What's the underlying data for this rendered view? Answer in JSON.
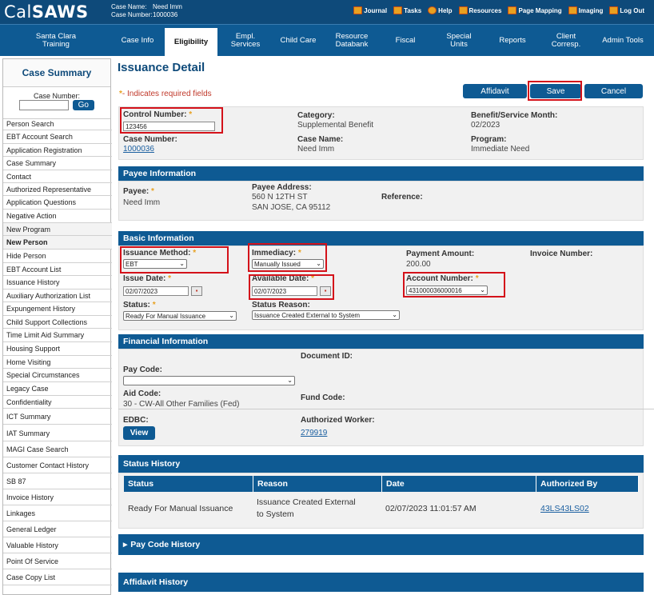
{
  "header": {
    "logo_prefix": "Cal",
    "logo_bold": "SAWS",
    "case_name_label": "Case Name:",
    "case_name": "Need Imm",
    "case_number_label": "Case Number:",
    "case_number": "1000036",
    "links": [
      {
        "label": "Journal",
        "icon": "journal-icon"
      },
      {
        "label": "Tasks",
        "icon": "tasks-icon"
      },
      {
        "label": "Help",
        "icon": "help-icon"
      },
      {
        "label": "Resources",
        "icon": "resources-icon"
      },
      {
        "label": "Page Mapping",
        "icon": "page-mapping-icon"
      },
      {
        "label": "Imaging",
        "icon": "imaging-icon"
      },
      {
        "label": "Log Out",
        "icon": "logout-icon"
      }
    ]
  },
  "nav": {
    "county_line1": "Santa Clara",
    "county_line2": "Training",
    "tabs": [
      {
        "line1": "Case Info",
        "line2": ""
      },
      {
        "line1": "Eligibility",
        "line2": ""
      },
      {
        "line1": "Empl.",
        "line2": "Services"
      },
      {
        "line1": "Child Care",
        "line2": ""
      },
      {
        "line1": "Resource",
        "line2": "Databank"
      },
      {
        "line1": "Fiscal",
        "line2": ""
      },
      {
        "line1": "Special",
        "line2": "Units"
      },
      {
        "line1": "Reports",
        "line2": ""
      },
      {
        "line1": "Client",
        "line2": "Corresp."
      },
      {
        "line1": "Admin Tools",
        "line2": ""
      }
    ]
  },
  "sidebar": {
    "title": "Case Summary",
    "case_number_label": "Case Number:",
    "go_label": "Go",
    "items": [
      "Person Search",
      "EBT Account Search",
      "Application Registration",
      "Case Summary",
      "Contact",
      "Authorized Representative",
      "Application Questions",
      "Negative Action",
      "New Program",
      "New Person",
      "Hide Person",
      "EBT Account List",
      "Issuance History",
      "Auxiliary Authorization List",
      "Expungement History",
      "Child Support Collections",
      "Time Limit Aid Summary",
      "Housing Support",
      "Home Visiting",
      "Special Circumstances",
      "Legacy Case",
      "Confidentiality",
      "ICT Summary",
      "IAT Summary",
      "MAGI Case Search",
      "Customer Contact History",
      "SB 87",
      "Invoice History",
      "Linkages",
      "General Ledger",
      "Valuable History",
      "Point Of Service",
      "Case Copy List"
    ]
  },
  "page": {
    "title": "Issuance Detail",
    "required_note": "- Indicates required fields",
    "required_star": "*",
    "buttons": {
      "affidavit": "Affidavit",
      "save": "Save",
      "cancel": "Cancel"
    }
  },
  "summary": {
    "control_number_label": "Control Number:",
    "control_number": "123456",
    "category_label": "Category:",
    "category": "Supplemental Benefit",
    "benefit_month_label": "Benefit/Service Month:",
    "benefit_month": "02/2023",
    "case_number_label": "Case Number:",
    "case_number": "1000036",
    "case_name_label": "Case Name:",
    "case_name": "Need Imm",
    "program_label": "Program:",
    "program": "Immediate Need"
  },
  "payee": {
    "section_title": "Payee Information",
    "payee_label": "Payee:",
    "payee": "Need Imm",
    "address_label": "Payee Address:",
    "address_line1": "560 N 12TH ST",
    "address_line2": "SAN JOSE, CA 95112",
    "reference_label": "Reference:"
  },
  "basic": {
    "section_title": "Basic Information",
    "issuance_method_label": "Issuance Method:",
    "issuance_method": "EBT",
    "immediacy_label": "Immediacy:",
    "immediacy": "Manually Issued",
    "payment_amount_label": "Payment Amount:",
    "payment_amount": "200.00",
    "invoice_number_label": "Invoice Number:",
    "issue_date_label": "Issue Date:",
    "issue_date": "02/07/2023",
    "available_date_label": "Available Date:",
    "available_date": "02/07/2023",
    "account_number_label": "Account Number:",
    "account_number": "431000036000016",
    "status_label": "Status:",
    "status": "Ready For Manual Issuance",
    "status_reason_label": "Status Reason:",
    "status_reason": "Issuance Created External to System"
  },
  "financial": {
    "section_title": "Financial Information",
    "document_id_label": "Document ID:",
    "pay_code_label": "Pay Code:",
    "pay_code": "",
    "aid_code_label": "Aid Code:",
    "aid_code": "30 - CW-All Other Families (Fed)",
    "fund_code_label": "Fund Code:",
    "edbc_label": "EDBC:",
    "view_label": "View",
    "authorized_worker_label": "Authorized Worker:",
    "authorized_worker": "279919"
  },
  "status_history": {
    "section_title": "Status History",
    "columns": [
      "Status",
      "Reason",
      "Date",
      "Authorized By"
    ],
    "rows": [
      {
        "status": "Ready For Manual Issuance",
        "reason_line1": "Issuance Created External",
        "reason_line2": "to System",
        "date": "02/07/2023 11:01:57 AM",
        "authorized_by": "43LS43LS02"
      }
    ]
  },
  "pay_code_history": {
    "section_title": "Pay Code History",
    "arrow": "▸"
  },
  "affidavit_history": {
    "section_title": "Affidavit History"
  },
  "colors": {
    "brand": "#0e5a93",
    "highlight": "#d4121a",
    "required": "#e8a120"
  }
}
